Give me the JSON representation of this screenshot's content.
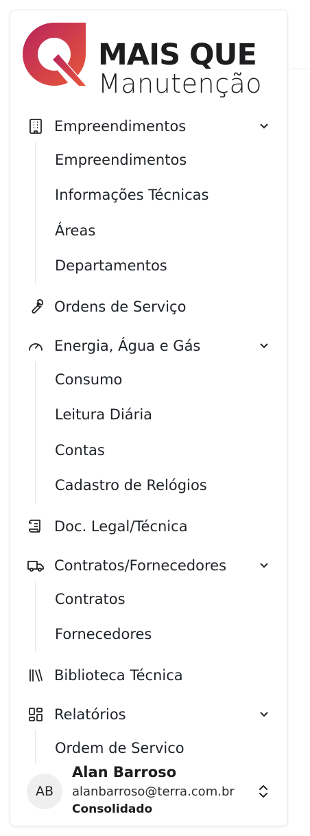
{
  "brand": {
    "line1": "MAIS QUE",
    "line2": "Manutenção",
    "logo_gradient": [
      "#c5285a",
      "#e8563a"
    ]
  },
  "nav": {
    "empreendimentos": {
      "label": "Empreendimentos",
      "icon": "building-icon",
      "children": [
        "Empreendimentos",
        "Informações Técnicas",
        "Áreas",
        "Departamentos"
      ]
    },
    "ordens": {
      "label": "Ordens de Serviço",
      "icon": "wrench-icon"
    },
    "energia": {
      "label": "Energia, Água e Gás",
      "icon": "gauge-icon",
      "children": [
        "Consumo",
        "Leitura Diária",
        "Contas",
        "Cadastro de Relógios"
      ]
    },
    "doc": {
      "label": "Doc. Legal/Técnica",
      "icon": "scroll-icon"
    },
    "contratos": {
      "label": "Contratos/Fornecedores",
      "icon": "truck-icon",
      "children": [
        "Contratos",
        "Fornecedores"
      ]
    },
    "biblioteca": {
      "label": "Biblioteca Técnica",
      "icon": "library-icon"
    },
    "relatorios": {
      "label": "Relatórios",
      "icon": "dashboard-icon",
      "children": [
        "Ordem de Servico"
      ]
    }
  },
  "user": {
    "initials": "AB",
    "name": "Alan Barroso",
    "email": "alanbarroso@terra.com.br",
    "org": "Consolidado"
  }
}
